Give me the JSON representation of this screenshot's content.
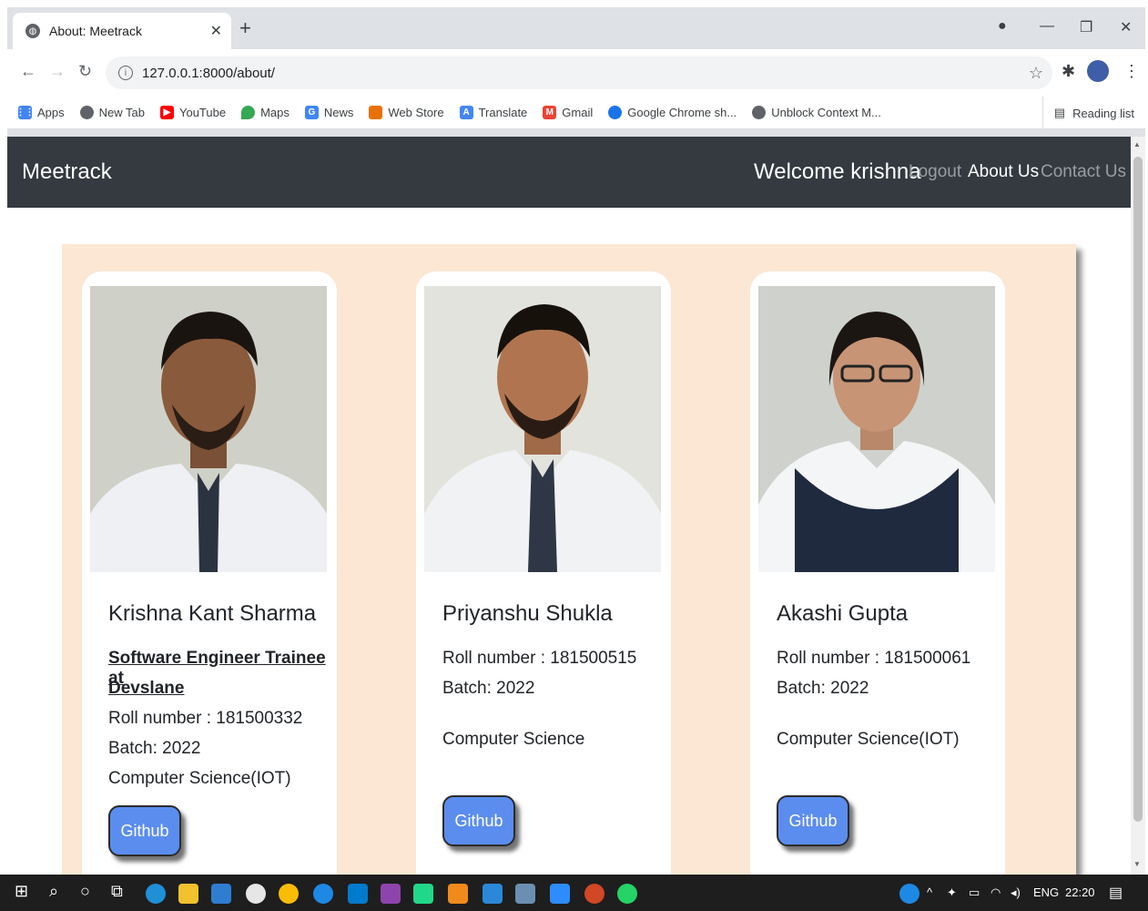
{
  "browser": {
    "tab_title": "About: Meetrack",
    "url": "127.0.0.1:8000/about/",
    "bookmarks": [
      "Apps",
      "New Tab",
      "YouTube",
      "Maps",
      "News",
      "Web Store",
      "Translate",
      "Gmail",
      "Google Chrome sh...",
      "Unblock Context M..."
    ],
    "reading_list": "Reading list"
  },
  "navbar": {
    "brand": "Meetrack",
    "welcome": "Welcome krishna",
    "logout": "Logout",
    "about": "About Us",
    "contact": "Contact Us"
  },
  "cards": [
    {
      "name": "Krishna Kant Sharma",
      "job_line1": "Software Engineer Trainee at",
      "job_line2": "Devslane",
      "roll": "Roll number : 181500332",
      "batch": "Batch: 2022",
      "branch": "Computer Science(IOT)",
      "button": "Github"
    },
    {
      "name": "Priyanshu Shukla",
      "roll": "Roll number : 181500515",
      "batch": "Batch: 2022",
      "branch": "Computer Science",
      "button": "Github"
    },
    {
      "name": "Akashi Gupta",
      "roll": "Roll number : 181500061",
      "batch": "Batch: 2022",
      "branch": "Computer Science(IOT)",
      "button": "Github"
    }
  ],
  "taskbar": {
    "language": "ENG",
    "time": "22:20"
  },
  "colors": {
    "navbar_bg": "#343a40",
    "container_bg": "#fbe7d4",
    "github_button": "#5b8def"
  }
}
